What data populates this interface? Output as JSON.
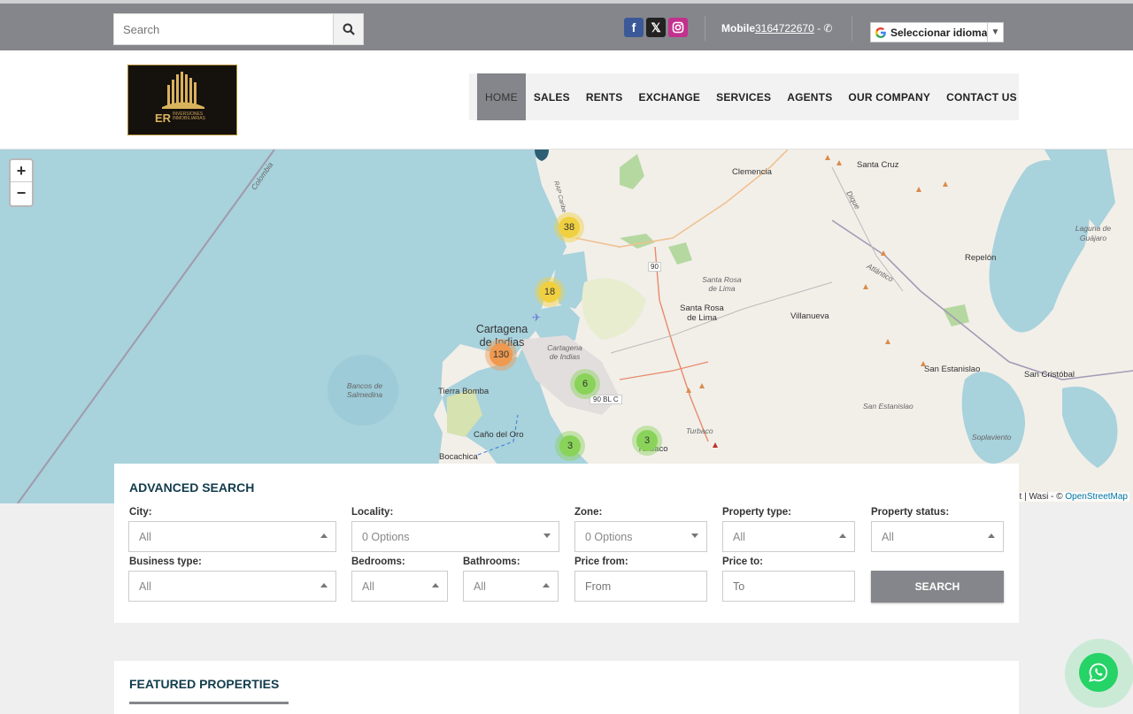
{
  "topbar": {
    "search_placeholder": "Search",
    "mobile_label": "Mobile",
    "mobile_number": "3164722670",
    "mobile_suffix": " - ",
    "language_label": "Seleccionar idioma"
  },
  "header": {
    "logo_text": "ER",
    "logo_sub": "INVERSIONES INMOBILIARIAS",
    "nav": [
      "HOME",
      "SALES",
      "RENTS",
      "EXCHANGE",
      "SERVICES",
      "AGENTS",
      "OUR COMPANY",
      "CONTACT US"
    ]
  },
  "map": {
    "clusters": [
      {
        "count": "38",
        "color": "#f0d040"
      },
      {
        "count": "18",
        "color": "#f0d040"
      },
      {
        "count": "130",
        "color": "#f09a50"
      },
      {
        "count": "6",
        "color": "#8ad35a"
      },
      {
        "count": "3",
        "color": "#8ad35a"
      },
      {
        "count": "3",
        "color": "#8ad35a"
      }
    ],
    "labels": {
      "clemencia": "Clemencia",
      "santa_cruz": "Santa Cruz",
      "laguna": "Laguna de Guájaro",
      "repelon": "Repelón",
      "santa_rosa_it": "Santa Rosa de Lima",
      "santa_rosa": "Santa Rosa de Lima",
      "villanueva": "Villanueva",
      "cartagena": "Cartagena de Indias",
      "cartagena_it": "Cartagena de Indias",
      "tierra_bomba": "Tierra Bomba",
      "bancos": "Bancos de Salmedina",
      "cano_oro": "Caño del Oro",
      "bocachica": "Bocachica",
      "turbaco": "Turbaco",
      "turbaco_it": "Turbaco",
      "san_estanislao": "San Estanislao",
      "san_estanislao_it": "San Estanislao",
      "san_cristobal": "San Cristóbal",
      "soplaviento": "Soplaviento",
      "colombia": "Colombia",
      "atlantico": "Atlántico",
      "dique": "Dique",
      "r90": "90",
      "r90blc": "90 BL C",
      "rap": "RAP Caribe"
    },
    "attribution_prefix": "et | Wasi - © ",
    "attribution_link": "OpenStreetMap"
  },
  "advanced_search": {
    "title": "ADVANCED SEARCH",
    "city": {
      "label": "City:",
      "value": "All"
    },
    "locality": {
      "label": "Locality:",
      "value": "0 Options"
    },
    "zone": {
      "label": "Zone:",
      "value": "0 Options"
    },
    "property_type": {
      "label": "Property type:",
      "value": "All"
    },
    "property_status": {
      "label": "Property status:",
      "value": "All"
    },
    "business_type": {
      "label": "Business type:",
      "value": "All"
    },
    "bedrooms": {
      "label": "Bedrooms:",
      "value": "All"
    },
    "bathrooms": {
      "label": "Bathrooms:",
      "value": "All"
    },
    "price_from": {
      "label": "Price from:",
      "placeholder": "From"
    },
    "price_to": {
      "label": "Price to:",
      "placeholder": "To"
    },
    "search_button": "SEARCH"
  },
  "featured": {
    "title": "FEATURED PROPERTIES"
  }
}
